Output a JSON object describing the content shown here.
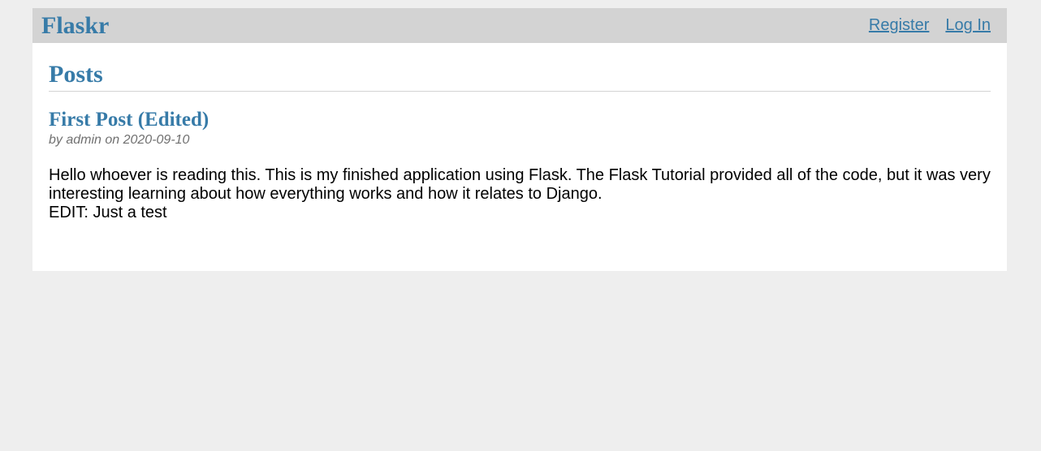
{
  "nav": {
    "brand": "Flaskr",
    "links": [
      {
        "label": "Register"
      },
      {
        "label": "Log In"
      }
    ]
  },
  "header": {
    "title": "Posts"
  },
  "posts": [
    {
      "title": "First Post (Edited)",
      "about": "by admin on 2020-09-10",
      "body": "Hello whoever is reading this. This is my finished application using Flask. The Flask Tutorial provided all of the code, but it was very interesting learning about how everything works and how it relates to Django.\nEDIT: Just a test"
    }
  ],
  "colors": {
    "background": "#eeeeee",
    "nav_background": "#d3d3d3",
    "accent": "#377ba8",
    "muted_text": "#707070",
    "divider": "#d3d3d3"
  }
}
